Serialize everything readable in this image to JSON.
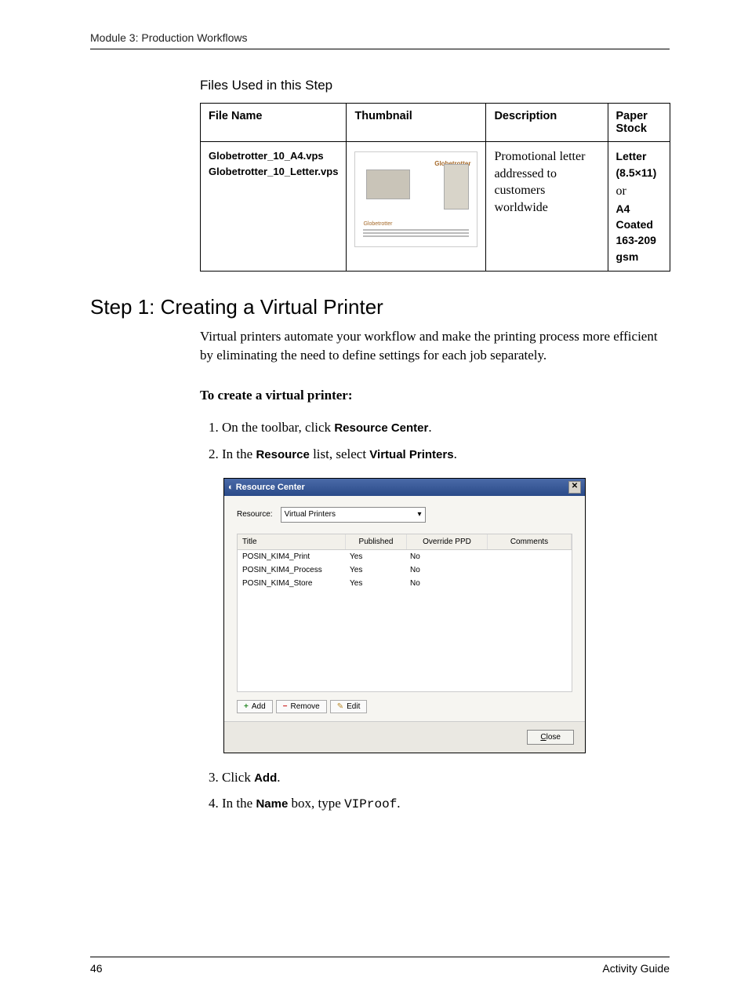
{
  "header": "Module 3: Production Workflows",
  "section_title": "Files Used in this Step",
  "table": {
    "headers": [
      "File Name",
      "Thumbnail",
      "Description",
      "Paper Stock"
    ],
    "row": {
      "filenames": [
        "Globetrotter_10_A4.vps",
        "Globetrotter_10_Letter.vps"
      ],
      "thumb_logo": "Globetrotter",
      "description": "Promotional letter addressed to customers worldwide",
      "stock": {
        "line1a": "Letter",
        "line1b": "(8.5×11)",
        "line1c": " or ",
        "line2": "A4",
        "line3": "Coated",
        "line4": "163-209 gsm"
      }
    }
  },
  "step_heading": "Step 1: Creating a Virtual Printer",
  "intro": "Virtual printers automate your workflow and make the printing process more efficient by eliminating the need to define settings for each job separately.",
  "proc_title": "To create a virtual printer:",
  "steps": {
    "s1a": "On the toolbar, click ",
    "s1b": "Resource Center",
    "s1c": ".",
    "s2a": "In the ",
    "s2b": "Resource",
    "s2c": " list, select ",
    "s2d": "Virtual Printers",
    "s2e": ".",
    "s3a": "Click ",
    "s3b": "Add",
    "s3c": ".",
    "s4a": "In the ",
    "s4b": "Name",
    "s4c": " box, type ",
    "s4d": "VIProof",
    "s4e": "."
  },
  "dialog": {
    "title": "Resource Center",
    "resource_label": "Resource:",
    "resource_value": "Virtual Printers",
    "columns": [
      "Title",
      "Published",
      "Override PPD",
      "Comments"
    ],
    "rows": [
      {
        "title": "POSIN_KIM4_Print",
        "published": "Yes",
        "override": "No",
        "comments": ""
      },
      {
        "title": "POSIN_KIM4_Process",
        "published": "Yes",
        "override": "No",
        "comments": ""
      },
      {
        "title": "POSIN_KIM4_Store",
        "published": "Yes",
        "override": "No",
        "comments": ""
      }
    ],
    "buttons": {
      "add": "Add",
      "remove": "Remove",
      "edit": "Edit",
      "close": "Close"
    }
  },
  "footer": {
    "page": "46",
    "doc": "Activity Guide"
  }
}
